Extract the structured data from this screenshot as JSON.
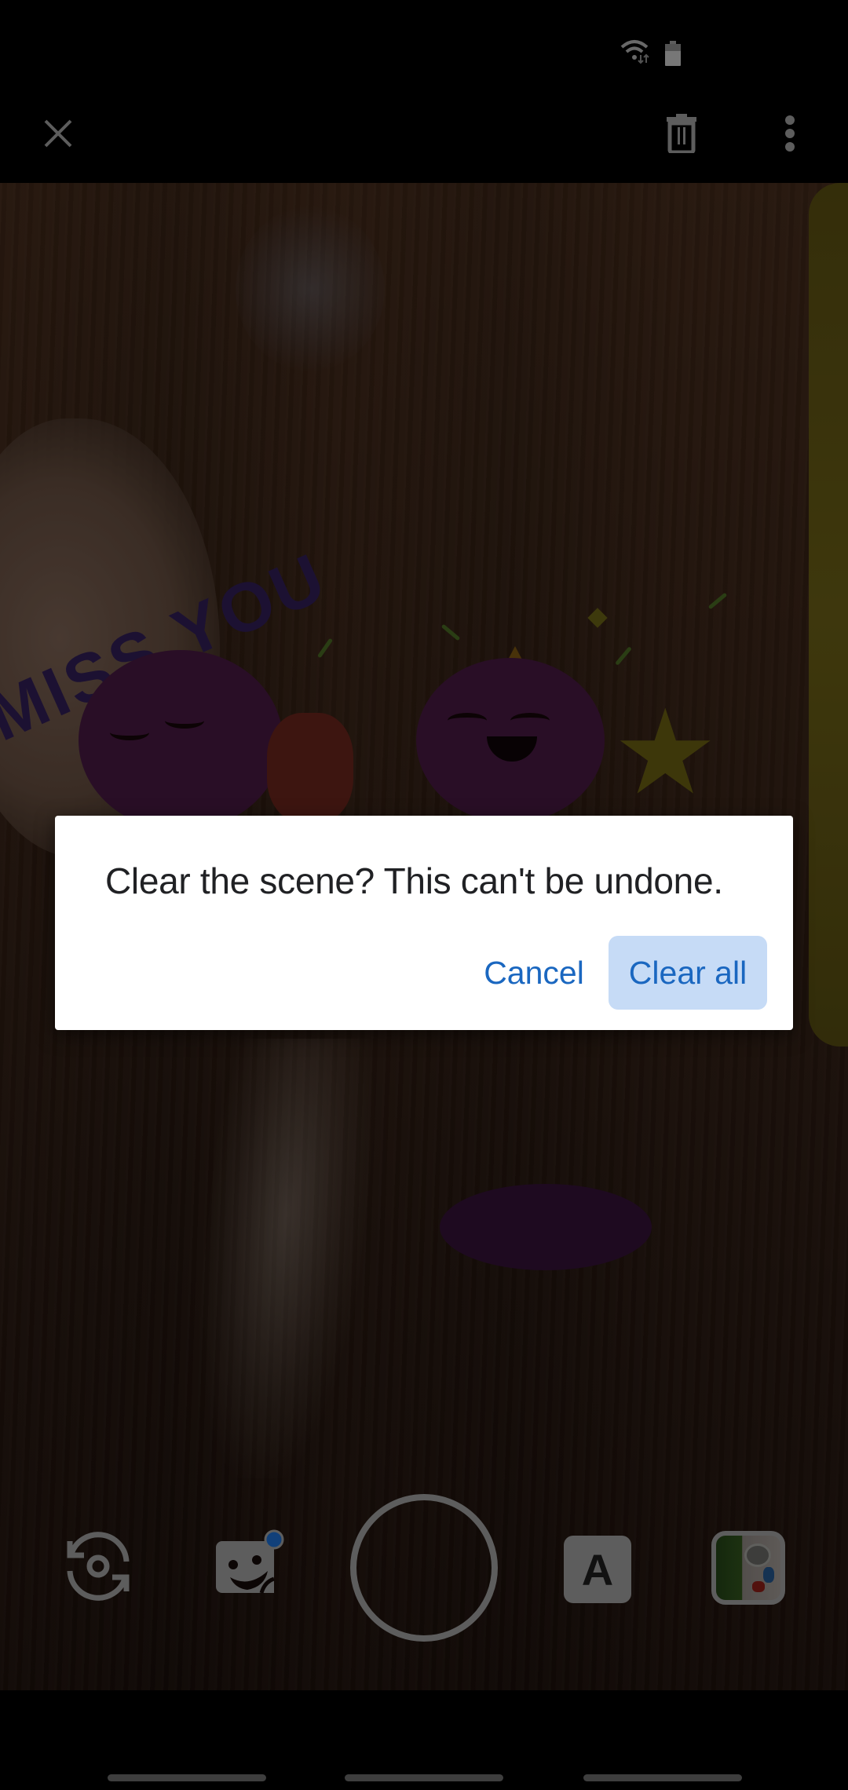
{
  "app": {
    "screen": "AR camera playground scene"
  },
  "status_bar": {
    "icons": [
      "wifi-icon",
      "battery-icon"
    ]
  },
  "top_bar": {
    "close_icon": "close-icon",
    "delete_icon": "trash-icon",
    "more_icon": "more-vert-icon"
  },
  "scene": {
    "sticker_text": "MISS YOU",
    "stickers": [
      "sad-octopus",
      "party-octopus",
      "laughing-star",
      "faded-octopus",
      "confetti"
    ]
  },
  "dialog": {
    "message": "Clear the scene? This can't be undone.",
    "cancel_label": "Cancel",
    "confirm_label": "Clear all",
    "accent_color": "#1a67c0",
    "confirm_bg_color": "#c6dbf6"
  },
  "controls": {
    "flip_camera_icon": "flip-camera-icon",
    "stickers_icon": "sticker-icon",
    "stickers_badge_color": "#1a5fb4",
    "shutter": "shutter-button",
    "text_label": "A",
    "gallery": "gallery-thumbnail"
  },
  "nav_bar": {
    "pills": 3
  }
}
